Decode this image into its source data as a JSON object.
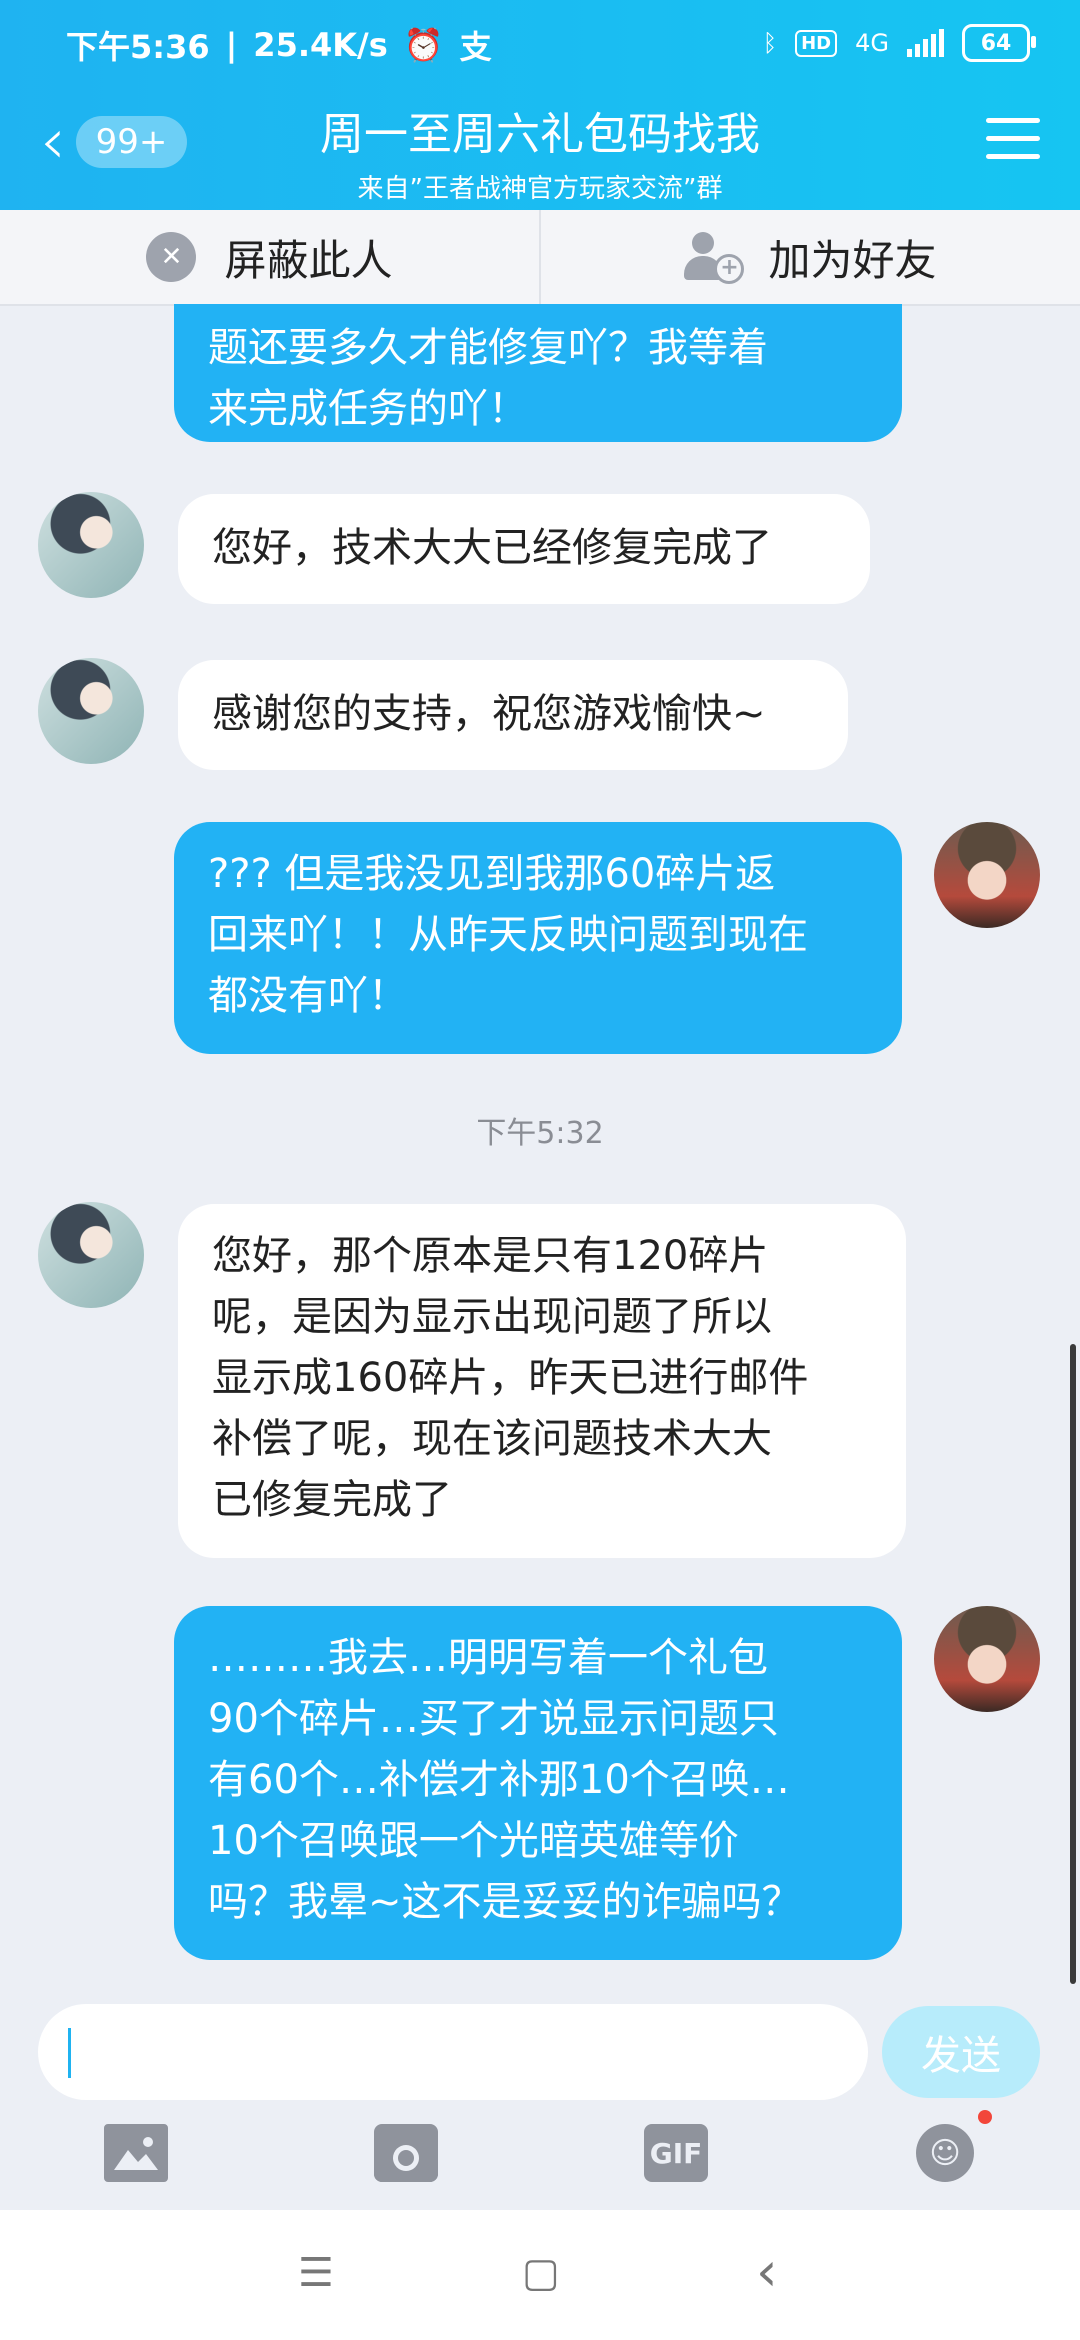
{
  "status_bar": {
    "time": "下午5:36",
    "speed": "25.4K/s",
    "network": "4G",
    "hd": "HD",
    "battery": "64"
  },
  "header": {
    "back_count": "99+",
    "title": "周一至周六礼包码找我",
    "subtitle": "来自”王者战神官方玩家交流”群"
  },
  "actions": {
    "block_label": "屏蔽此人",
    "add_friend_label": "加为好友"
  },
  "messages": [
    {
      "sender": "me",
      "text_lines": [
        "题还要多久才能修复吖？我等着",
        "来完成任务的吖！"
      ]
    },
    {
      "sender": "other",
      "text_lines": [
        "您好，技术大大已经修复完成了"
      ]
    },
    {
      "sender": "other",
      "text_lines": [
        "感谢您的支持，祝您游戏愉快~"
      ]
    },
    {
      "sender": "me",
      "text_lines": [
        "??? 但是我没见到我那60碎片返",
        "回来吖！！从昨天反映问题到现在",
        "都没有吖！"
      ]
    },
    {
      "sender": "other",
      "text_lines": [
        "您好，那个原本是只有120碎片",
        "呢，是因为显示出现问题了所以",
        "显示成160碎片，昨天已进行邮件",
        "补偿了呢，现在该问题技术大大",
        "已修复完成了"
      ]
    },
    {
      "sender": "me",
      "text_lines": [
        "………我去…明明写着一个礼包",
        "90个碎片…买了才说显示问题只",
        "有60个…补偿才补那10个召唤…",
        "10个召唤跟一个光暗英雄等价",
        "吗？我晕~这不是妥妥的诈骗吗？"
      ]
    }
  ],
  "timestamp": "下午5:32",
  "composer": {
    "input_value": "",
    "send_label": "发送",
    "gif_label": "GIF"
  },
  "nav": {
    "menu": "☰",
    "home": "▢",
    "back": "‹"
  }
}
